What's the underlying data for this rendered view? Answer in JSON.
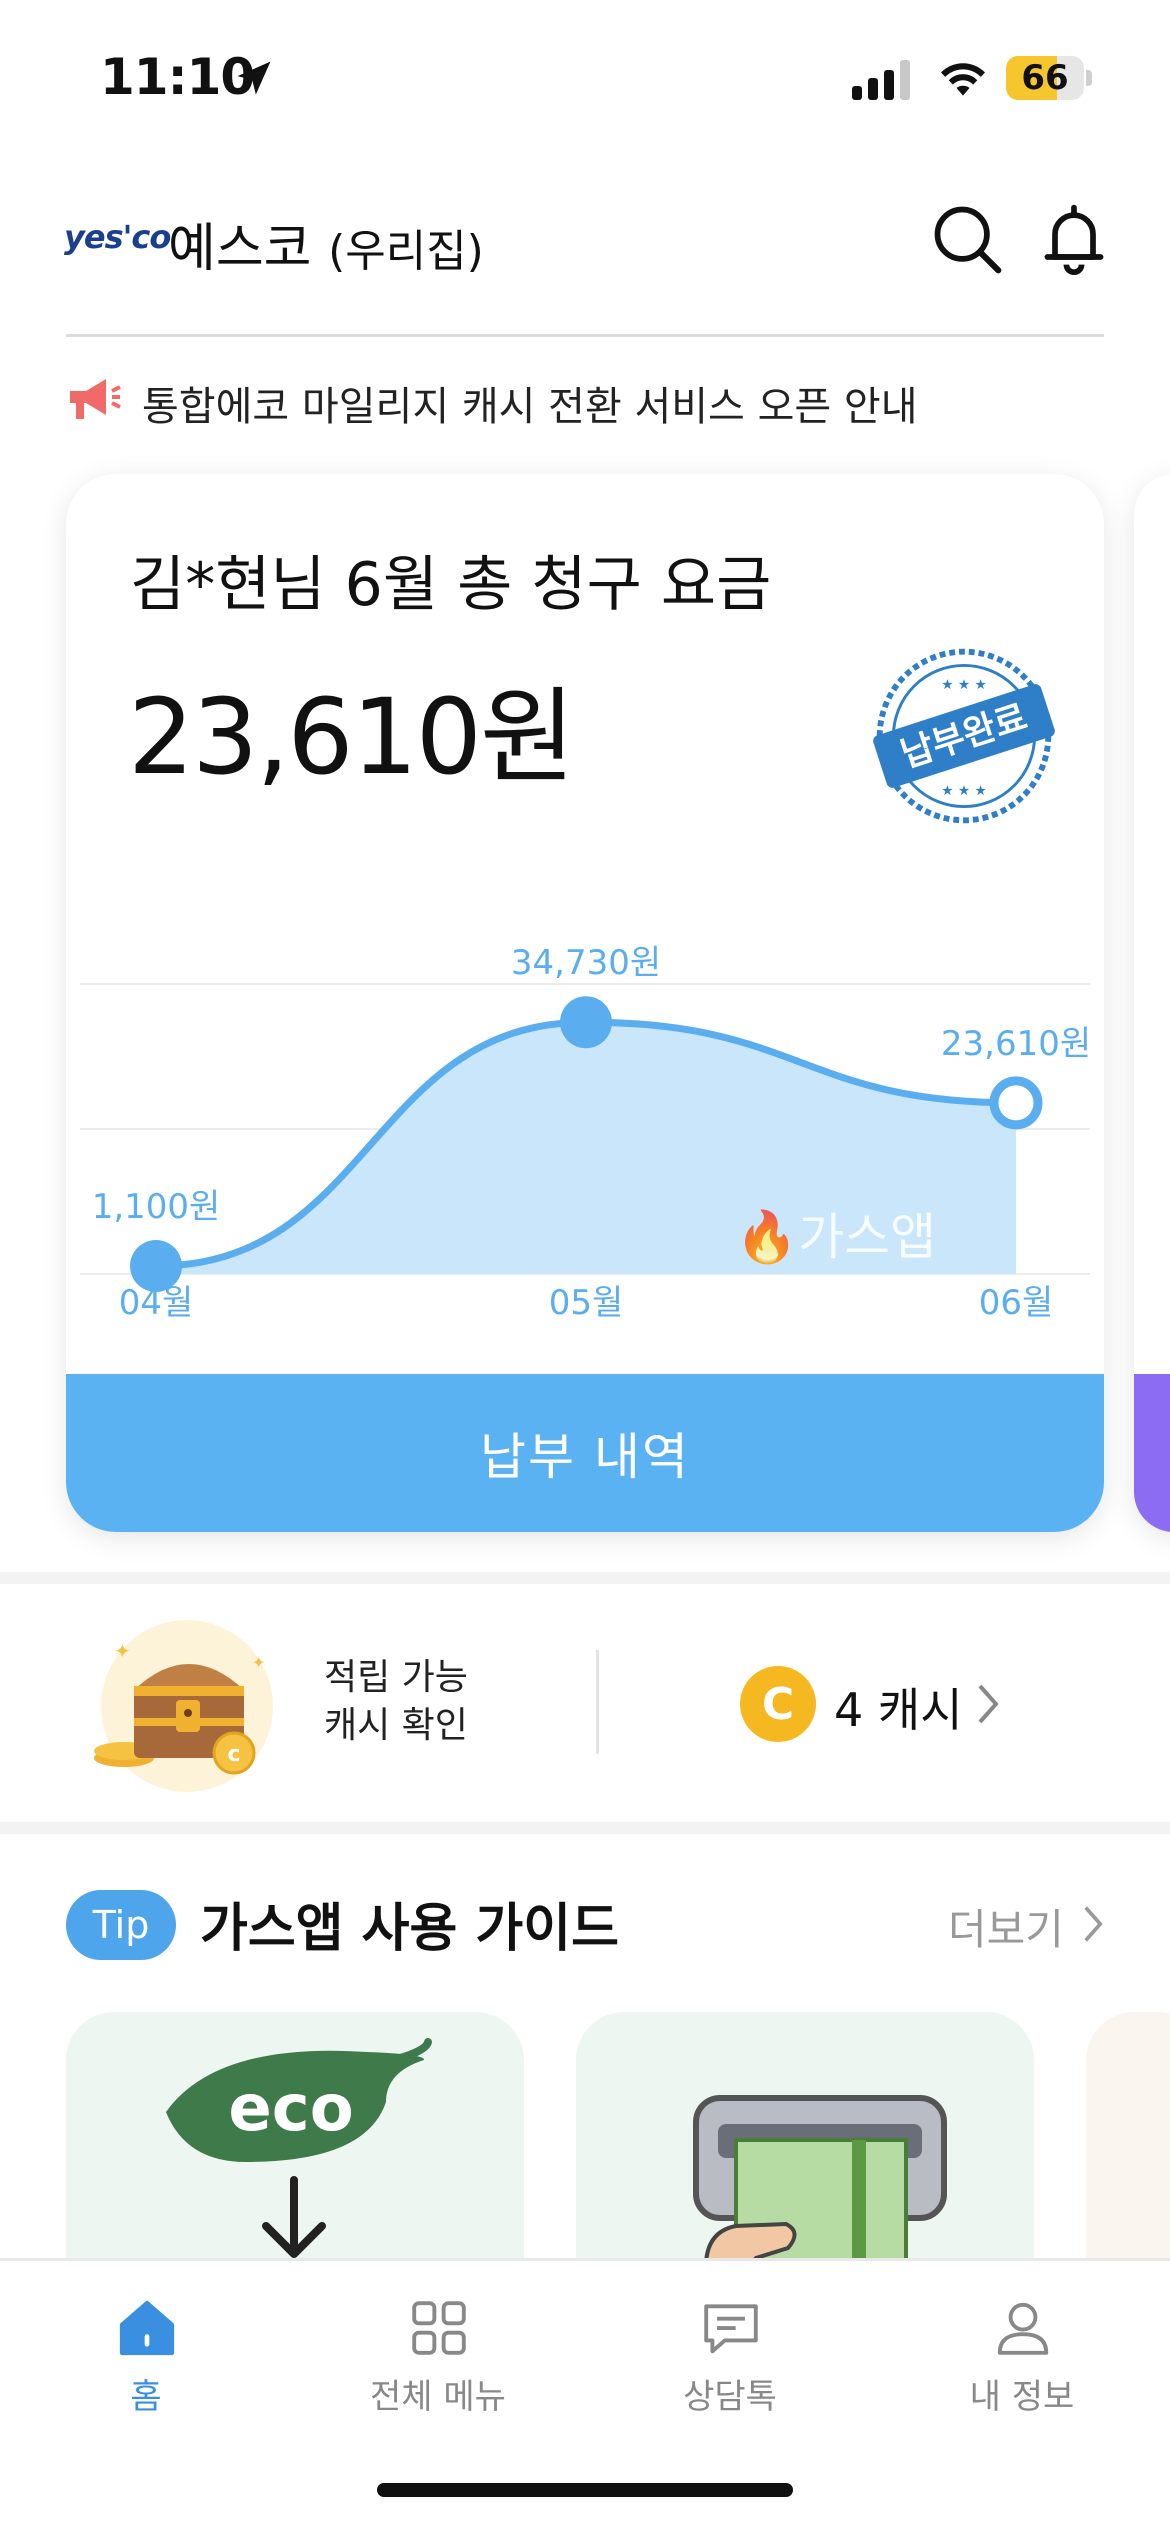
{
  "status_bar": {
    "time": "11:10",
    "battery": "66",
    "battery_level": 0.66
  },
  "header": {
    "logo_text": "yes'co",
    "title": "예스코",
    "subtitle": "(우리집)"
  },
  "notice": {
    "text": "통합에코 마일리지 캐시 전환 서비스 오픈 안내"
  },
  "bill": {
    "title": "김*현님 6월 총 청구 요금",
    "amount": "23,610원",
    "stamp_text": "납부완료",
    "watermark": "가스앱",
    "button_label": "납부 내역"
  },
  "chart_data": {
    "type": "area",
    "categories": [
      "04월",
      "05월",
      "06월"
    ],
    "values": [
      1100,
      34730,
      23610
    ],
    "data_labels": [
      "1,100원",
      "34,730원",
      "23,610원"
    ],
    "ylim": [
      0,
      40000
    ],
    "grid": true,
    "color": "#5aaef0",
    "fill": "#c9e6fb"
  },
  "cash": {
    "label_line1": "적립 가능",
    "label_line2": "캐시 확인",
    "coin_symbol": "C",
    "value": "4 캐시"
  },
  "guide": {
    "tip_label": "Tip",
    "title": "가스앱 사용 가이드",
    "more_label": "더보기",
    "eco_text": "eco"
  },
  "nav": {
    "items": [
      {
        "label": "홈",
        "icon": "home-icon",
        "active": true
      },
      {
        "label": "전체 메뉴",
        "icon": "grid-icon",
        "active": false
      },
      {
        "label": "상담톡",
        "icon": "chat-icon",
        "active": false
      },
      {
        "label": "내 정보",
        "icon": "person-icon",
        "active": false
      }
    ]
  },
  "colors": {
    "accent": "#5bb2f2",
    "tip_badge": "#4ea5ec",
    "coin": "#f5b820",
    "active_nav": "#3b8fe0",
    "notice_icon": "#f06a6a"
  }
}
